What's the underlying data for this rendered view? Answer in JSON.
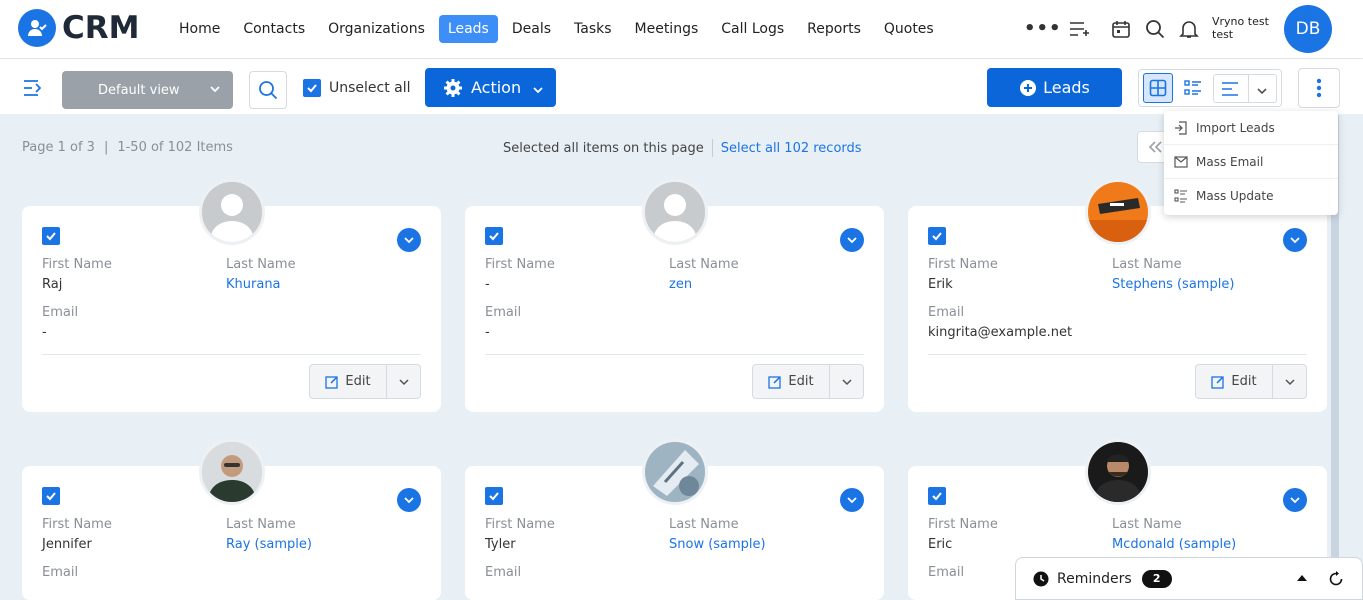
{
  "app": {
    "logo_text": "CRM"
  },
  "nav": {
    "items": [
      {
        "label": "Home",
        "active": false
      },
      {
        "label": "Contacts",
        "active": false
      },
      {
        "label": "Organizations",
        "active": false
      },
      {
        "label": "Leads",
        "active": true
      },
      {
        "label": "Deals",
        "active": false
      },
      {
        "label": "Tasks",
        "active": false
      },
      {
        "label": "Meetings",
        "active": false
      },
      {
        "label": "Call Logs",
        "active": false
      },
      {
        "label": "Reports",
        "active": false
      },
      {
        "label": "Quotes",
        "active": false
      }
    ],
    "more_label": "•••",
    "user_name": "Vryno test test",
    "user_initials": "DB"
  },
  "toolbar": {
    "view_select": "Default view",
    "unselect_label": "Unselect all",
    "action_label": "Action",
    "leads_label": "Leads"
  },
  "pagination": {
    "page": "Page 1 of 3",
    "range": "1-50 of 102 Items",
    "selected_text": "Selected all items on this page",
    "select_all_link": "Select all 102 records"
  },
  "dropdown": {
    "items": [
      "Import Leads",
      "Mass Email",
      "Mass Update"
    ]
  },
  "labels": {
    "first_name": "First Name",
    "last_name": "Last Name",
    "email": "Email",
    "edit": "Edit"
  },
  "cards": [
    {
      "first_name": "Raj",
      "last_name": "Khurana",
      "email": "-",
      "avatar": "placeholder"
    },
    {
      "first_name": "-",
      "last_name": "zen",
      "email": "-",
      "avatar": "placeholder"
    },
    {
      "first_name": "Erik",
      "last_name": "Stephens (sample)",
      "email": "kingrita@example.net",
      "avatar": "orange-photo"
    },
    {
      "first_name": "Jennifer",
      "last_name": "Ray (sample)",
      "email": "",
      "avatar": "man-glasses-photo"
    },
    {
      "first_name": "Tyler",
      "last_name": "Snow (sample)",
      "email": "",
      "avatar": "abstract-photo"
    },
    {
      "first_name": "Eric",
      "last_name": "Mcdonald (sample)",
      "email": "",
      "avatar": "man-beard-photo"
    }
  ],
  "reminders": {
    "label": "Reminders",
    "count": "2"
  },
  "colors": {
    "primary": "#1b74e4",
    "button": "#0a66d9",
    "page_bg": "#e8f0f6"
  }
}
